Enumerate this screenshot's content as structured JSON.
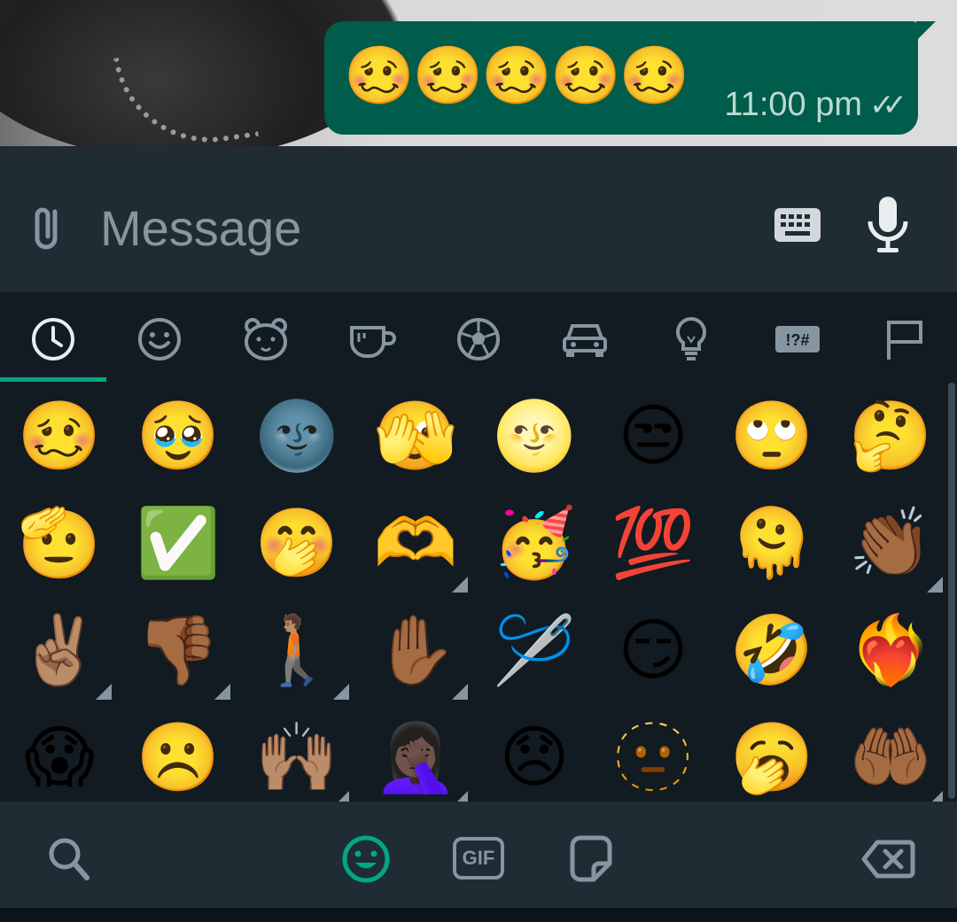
{
  "message": {
    "emojis": "🥴🥴🥴🥴🥴",
    "time": "11:00 pm",
    "status_icon": "double-check-icon"
  },
  "input": {
    "placeholder": "Message",
    "attach_icon": "paperclip-icon",
    "keyboard_icon": "keyboard-icon",
    "mic_icon": "microphone-icon"
  },
  "tabs": [
    {
      "name": "recent",
      "icon": "clock-icon",
      "selected": true
    },
    {
      "name": "smileys",
      "icon": "smiley-icon"
    },
    {
      "name": "animals",
      "icon": "bear-icon"
    },
    {
      "name": "food",
      "icon": "cup-icon"
    },
    {
      "name": "activities",
      "icon": "soccer-ball-icon"
    },
    {
      "name": "travel",
      "icon": "car-icon"
    },
    {
      "name": "objects",
      "icon": "lightbulb-icon"
    },
    {
      "name": "symbols",
      "icon": "symbols-icon",
      "label": "!?#"
    },
    {
      "name": "flags",
      "icon": "flag-icon"
    }
  ],
  "emoji_rows": [
    [
      "🥴",
      "🥹",
      "🌚",
      "🫣",
      "🌝",
      "😒",
      "🙄",
      "🤔"
    ],
    [
      "🫡",
      "✅",
      "🤭",
      "🫶",
      "🥳",
      "💯",
      "🫠",
      "👏🏾"
    ],
    [
      "✌🏽",
      "👎🏾",
      "🚶🏽",
      "✋🏾",
      "🪡",
      "😏",
      "🤣",
      "❤️‍🔥"
    ],
    [
      "😱",
      "☹️",
      "🙌🏽",
      "🤦🏿‍♀️",
      "😞",
      "🫥",
      "🥱",
      "🤲🏾"
    ]
  ],
  "skin_tone_cells": [
    [
      1,
      3
    ],
    [
      1,
      7
    ],
    [
      2,
      0
    ],
    [
      2,
      1
    ],
    [
      2,
      2
    ],
    [
      2,
      3
    ],
    [
      3,
      2
    ],
    [
      3,
      3
    ],
    [
      3,
      7
    ]
  ],
  "bottom_bar": {
    "search_icon": "search-icon",
    "emoji_icon": "emoji-icon",
    "gif_label": "GIF",
    "sticker_icon": "sticker-icon",
    "backspace_icon": "backspace-icon"
  },
  "colors": {
    "accent": "#00a884",
    "bubble": "#005c4b",
    "panel": "#1f2c34",
    "background": "#111b21",
    "icon": "#8696a0"
  }
}
